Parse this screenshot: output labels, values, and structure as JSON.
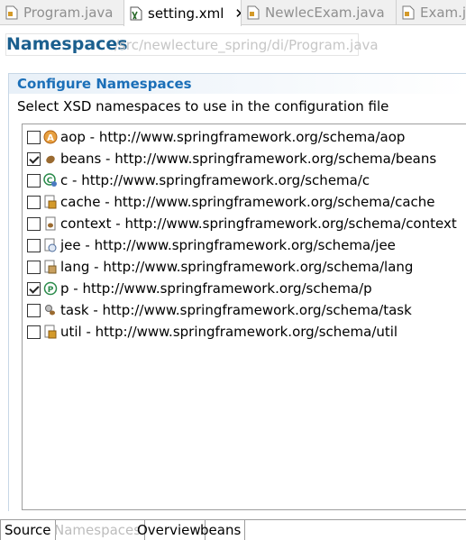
{
  "tabs": [
    {
      "label": "Program.java",
      "icon": "java-file-icon",
      "active": false
    },
    {
      "label": "setting.xml",
      "icon": "xml-file-icon",
      "active": true,
      "close": "✕"
    },
    {
      "label": "NewlecExam.java",
      "icon": "java-file-icon",
      "active": false
    },
    {
      "label": "Exam.java",
      "icon": "java-file-icon",
      "active": false
    }
  ],
  "header": {
    "title": "Namespaces",
    "path": "/src/newlecture_spring/di/Program.java"
  },
  "section": {
    "title": "Configure Namespaces",
    "description": "Select XSD namespaces to use in the configuration file"
  },
  "namespaces": [
    {
      "label": "aop - http://www.springframework.org/schema/aop",
      "checked": false,
      "icon": "aop-icon"
    },
    {
      "label": "beans - http://www.springframework.org/schema/beans",
      "checked": true,
      "icon": "beans-icon"
    },
    {
      "label": "c - http://www.springframework.org/schema/c",
      "checked": false,
      "icon": "c-namespace-icon"
    },
    {
      "label": "cache - http://www.springframework.org/schema/cache",
      "checked": false,
      "icon": "cache-icon"
    },
    {
      "label": "context - http://www.springframework.org/schema/context",
      "checked": false,
      "icon": "context-icon"
    },
    {
      "label": "jee - http://www.springframework.org/schema/jee",
      "checked": false,
      "icon": "jee-icon"
    },
    {
      "label": "lang - http://www.springframework.org/schema/lang",
      "checked": false,
      "icon": "lang-icon"
    },
    {
      "label": "p - http://www.springframework.org/schema/p",
      "checked": true,
      "icon": "p-namespace-icon"
    },
    {
      "label": "task - http://www.springframework.org/schema/task",
      "checked": false,
      "icon": "task-icon"
    },
    {
      "label": "util - http://www.springframework.org/schema/util",
      "checked": false,
      "icon": "util-icon"
    }
  ],
  "bottom_tabs": [
    {
      "label": "Source",
      "active": false
    },
    {
      "label": "Namespaces",
      "active": true
    },
    {
      "label": "Overview",
      "active": false
    },
    {
      "label": "beans",
      "active": false
    }
  ],
  "colors": {
    "header_title": "#1b5f8e",
    "section_title": "#1b6fb8"
  }
}
